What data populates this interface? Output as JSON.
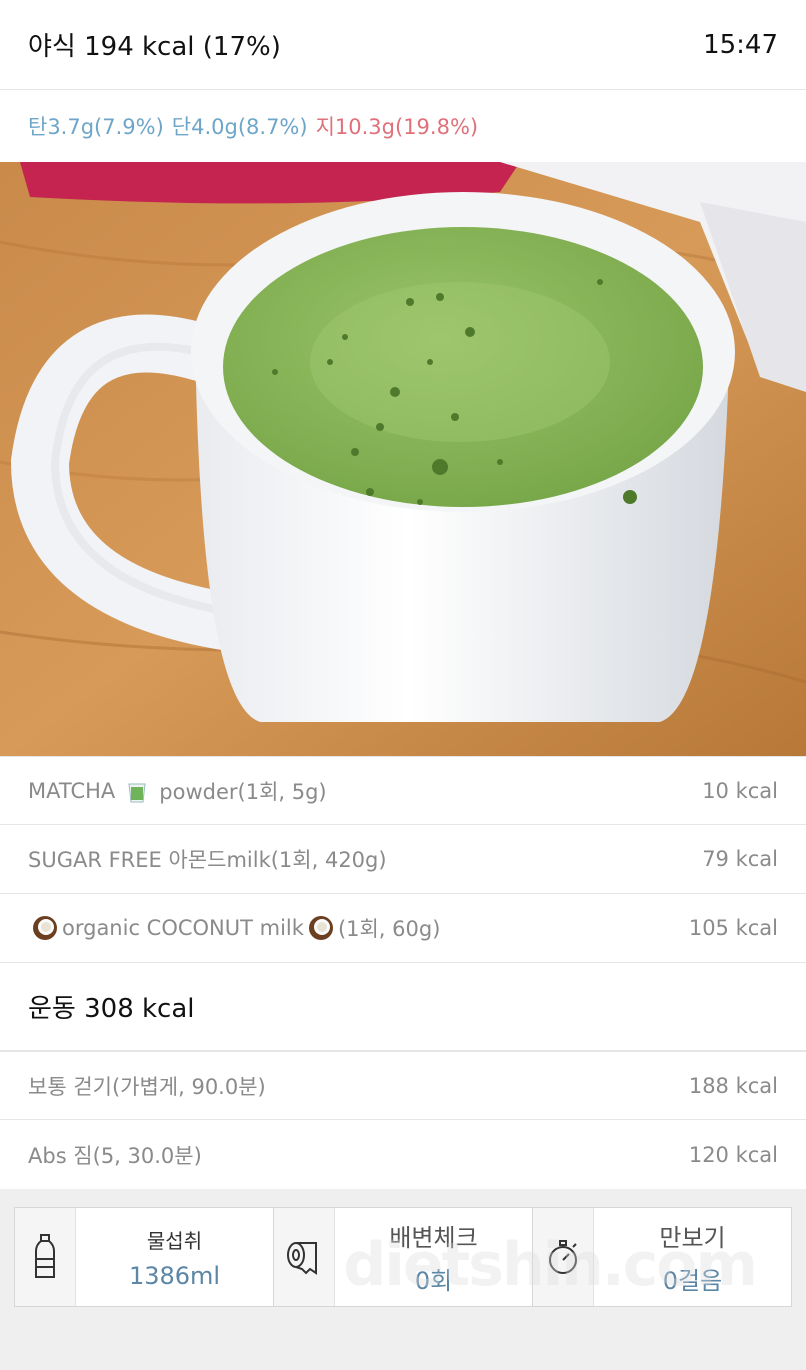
{
  "meal": {
    "title": "야식 194 kcal (17%)",
    "time": "15:47",
    "macros": {
      "carb": "탄3.7g(7.9%)",
      "protein": "단4.0g(8.7%)",
      "fat": "지10.3g(19.8%)"
    },
    "colors": {
      "carb": "#6ea6c9",
      "protein": "#6ea6c9",
      "fat": "#e0707a"
    }
  },
  "food_items": [
    {
      "prefix": "MATCHA",
      "suffix": "powder(1회, 5g)",
      "kcal": "10 kcal"
    },
    {
      "name": "SUGAR FREE 아몬드milk(1회, 420g)",
      "kcal": "79 kcal"
    },
    {
      "middle": "organic COCONUT milk",
      "suffix": "(1회, 60g)",
      "kcal": "105 kcal"
    }
  ],
  "exercise": {
    "title": "운동 308 kcal",
    "items": [
      {
        "name": "보통 걷기(가볍게, 90.0분)",
        "kcal": "188 kcal"
      },
      {
        "name": "Abs 짐(5, 30.0분)",
        "kcal": "120 kcal"
      }
    ]
  },
  "stats": [
    {
      "icon": "water-bottle-icon",
      "label": "물섭취",
      "value": "1386ml"
    },
    {
      "icon": "toilet-paper-icon",
      "label": "배변체크",
      "value": "0회"
    },
    {
      "icon": "stopwatch-icon",
      "label": "만보기",
      "value": "0걸음"
    }
  ],
  "watermark": "dietshin.com"
}
